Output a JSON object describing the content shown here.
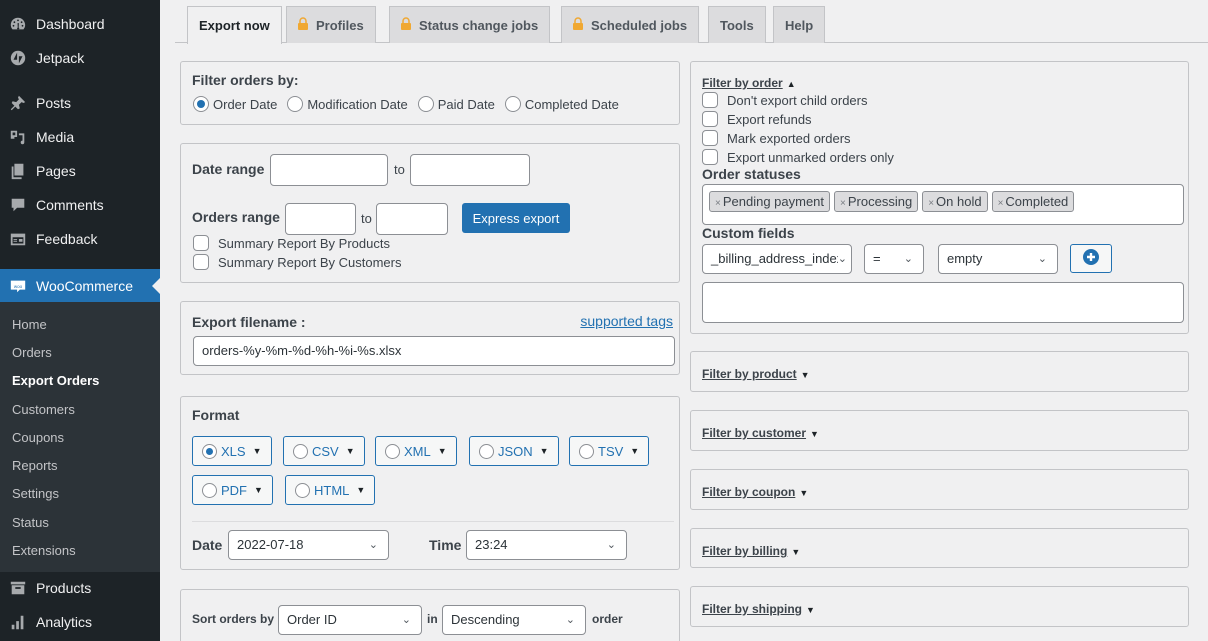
{
  "sidebar": {
    "items": [
      {
        "label": "Dashboard",
        "icon": "dashboard-icon"
      },
      {
        "label": "Jetpack",
        "icon": "jetpack-icon"
      },
      {
        "label": "Posts",
        "icon": "pin-icon"
      },
      {
        "label": "Media",
        "icon": "media-icon"
      },
      {
        "label": "Pages",
        "icon": "pages-icon"
      },
      {
        "label": "Comments",
        "icon": "comment-icon"
      },
      {
        "label": "Feedback",
        "icon": "feedback-icon"
      },
      {
        "label": "WooCommerce",
        "icon": "woo-icon"
      },
      {
        "label": "Products",
        "icon": "archive-icon"
      },
      {
        "label": "Analytics",
        "icon": "bar-chart-icon"
      }
    ],
    "submenu": [
      "Home",
      "Orders",
      "Export Orders",
      "Customers",
      "Coupons",
      "Reports",
      "Settings",
      "Status",
      "Extensions"
    ],
    "active_menu": "WooCommerce",
    "active_submenu": "Export Orders"
  },
  "tabs": [
    {
      "label": "Export now",
      "locked": false,
      "active": true
    },
    {
      "label": "Profiles",
      "locked": true,
      "active": false
    },
    {
      "label": "Status change jobs",
      "locked": true,
      "active": false
    },
    {
      "label": "Scheduled jobs",
      "locked": true,
      "active": false
    },
    {
      "label": "Tools",
      "locked": false,
      "active": false
    },
    {
      "label": "Help",
      "locked": false,
      "active": false
    }
  ],
  "filter_orders": {
    "title": "Filter orders by:",
    "options": [
      "Order Date",
      "Modification Date",
      "Paid Date",
      "Completed Date"
    ],
    "selected": "Order Date"
  },
  "ranges": {
    "date_label": "Date range",
    "to": "to",
    "date_from": "",
    "date_to": "",
    "orders_label": "Orders range",
    "orders_from": "",
    "orders_to": "",
    "express_button": "Express export",
    "summary_products": "Summary Report By Products",
    "summary_customers": "Summary Report By Customers"
  },
  "filename": {
    "label": "Export filename :",
    "link": "supported tags",
    "value": "orders-%y-%m-%d-%h-%i-%s.xlsx"
  },
  "format": {
    "label": "Format",
    "options": [
      "XLS",
      "CSV",
      "XML",
      "JSON",
      "TSV",
      "PDF",
      "HTML"
    ],
    "selected": "XLS",
    "date_label": "Date",
    "date_value": "2022-07-18",
    "time_label": "Time",
    "time_value": "23:24"
  },
  "sort": {
    "label": "Sort orders by",
    "field": "Order ID",
    "in": "in",
    "direction": "Descending",
    "suffix": "order"
  },
  "filter_by_order": {
    "title": "Filter by order",
    "checkboxes": [
      "Don't export child orders",
      "Export refunds",
      "Mark exported orders",
      "Export unmarked orders only"
    ],
    "statuses_label": "Order statuses",
    "statuses": [
      "Pending payment",
      "Processing",
      "On hold",
      "Completed"
    ],
    "custom_fields_label": "Custom fields",
    "custom_field": "_billing_address_index",
    "operator": "=",
    "value": "empty",
    "custom_text": ""
  },
  "collapsed_filters": [
    "Filter by product",
    "Filter by customer",
    "Filter by coupon",
    "Filter by billing",
    "Filter by shipping"
  ],
  "colors": {
    "accent": "#2271b1",
    "sidebar_bg": "#1d2327",
    "submenu_bg": "#2c3338",
    "lock": "#f0a832"
  }
}
